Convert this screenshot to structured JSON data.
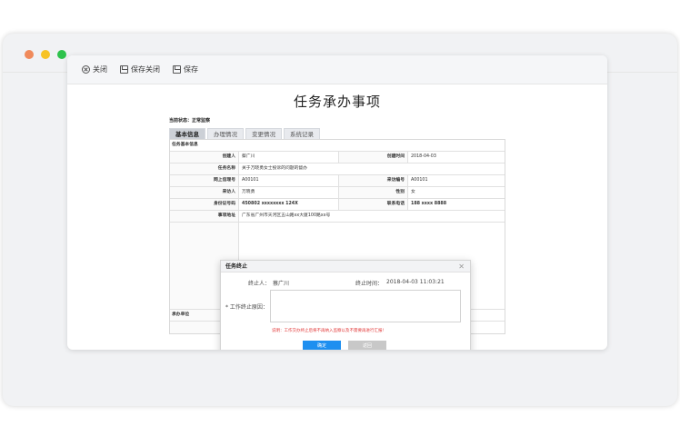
{
  "toolbar": {
    "close_label": "关闭",
    "save_close_label": "保存关闭",
    "save_label": "保存"
  },
  "form": {
    "title": "任务承办事项",
    "status": "当前状态：正常监察"
  },
  "tabs": [
    "基本信息",
    "办理情况",
    "变更情况",
    "系统记录"
  ],
  "section_title": "任务基本信息",
  "rows": [
    {
      "l1": "创建人",
      "v1": "蔡广川",
      "l2": "创建时间",
      "v2": "2018-04-03"
    },
    {
      "l1": "任务名称",
      "v1": "关于万晓勇女士投诉的问题的督办",
      "l2": "",
      "v2": ""
    },
    {
      "l1": "网上信理号",
      "v1": "A00101",
      "l2": "来访编号",
      "v2": "A00101"
    },
    {
      "l1": "来访人",
      "v1": "万晓勇",
      "l2": "性别",
      "v2": "女"
    },
    {
      "l1": "身份证号码",
      "v1": "450802 xxxxxxxx 124X",
      "l2": "联系电话",
      "v2": "188 xxxx 8888"
    },
    {
      "l1": "事项地址",
      "v1": "广东省广州市天河区五山路xx大厦100路xx号",
      "l2": "",
      "v2": ""
    }
  ],
  "undertaker_label": "承办单位",
  "dialog": {
    "title": "任务终止",
    "terminator_label": "终止人：",
    "terminator_value": "蔡广川",
    "time_label": "终止时间：",
    "time_value": "2018-04-03 11:03:21",
    "reason_label": "* 工作终止原因：",
    "note": "说明：工作交办终止后将不再纳入监察以及不需要再进行汇报!",
    "confirm_label": "确定",
    "cancel_label": "返回"
  }
}
